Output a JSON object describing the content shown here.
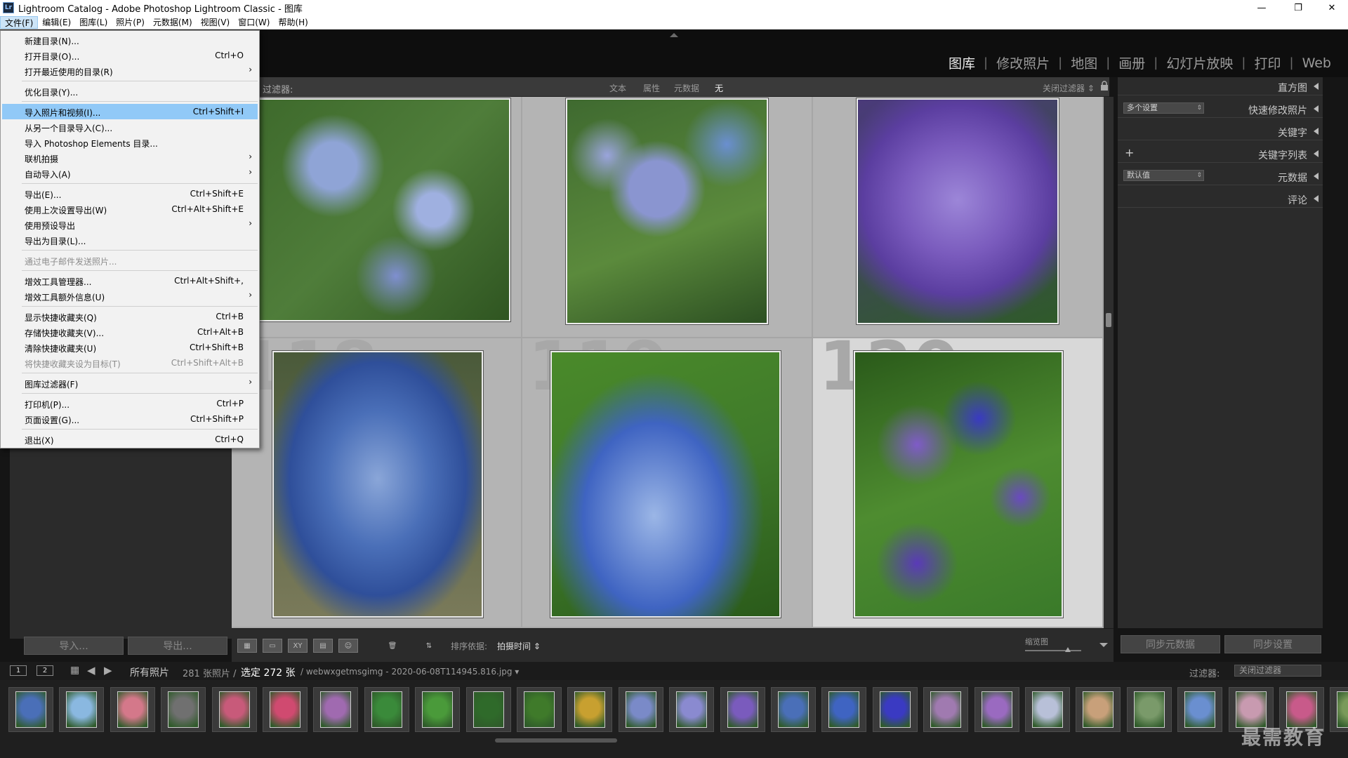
{
  "window": {
    "title": "Lightroom Catalog - Adobe Photoshop Lightroom Classic - 图库",
    "app_icon": "Lr",
    "controls": {
      "minimize": "—",
      "maximize": "❐",
      "close": "✕"
    }
  },
  "menubar": [
    "文件(F)",
    "编辑(E)",
    "图库(L)",
    "照片(P)",
    "元数据(M)",
    "视图(V)",
    "窗口(W)",
    "帮助(H)"
  ],
  "modules": [
    "图库",
    "修改照片",
    "地图",
    "画册",
    "幻灯片放映",
    "打印",
    "Web"
  ],
  "file_menu": {
    "items": [
      {
        "label": "新建目录(N)...",
        "shortcut": ""
      },
      {
        "label": "打开目录(O)...",
        "shortcut": "Ctrl+O"
      },
      {
        "label": "打开最近使用的目录(R)",
        "shortcut": "",
        "submenu": "›"
      },
      {
        "label": "优化目录(Y)...",
        "shortcut": ""
      },
      {
        "label": "导入照片和视频(I)...",
        "shortcut": "Ctrl+Shift+I"
      },
      {
        "label": "从另一个目录导入(C)...",
        "shortcut": ""
      },
      {
        "label": "导入 Photoshop Elements 目录...",
        "shortcut": ""
      },
      {
        "label": "联机拍摄",
        "shortcut": "",
        "submenu": "›"
      },
      {
        "label": "自动导入(A)",
        "shortcut": "",
        "submenu": "›"
      },
      {
        "label": "导出(E)...",
        "shortcut": "Ctrl+Shift+E"
      },
      {
        "label": "使用上次设置导出(W)",
        "shortcut": "Ctrl+Alt+Shift+E"
      },
      {
        "label": "使用预设导出",
        "shortcut": "",
        "submenu": "›"
      },
      {
        "label": "导出为目录(L)...",
        "shortcut": ""
      },
      {
        "label": "通过电子邮件发送照片...",
        "shortcut": ""
      },
      {
        "label": "增效工具管理器...",
        "shortcut": "Ctrl+Alt+Shift+,"
      },
      {
        "label": "增效工具额外信息(U)",
        "shortcut": "",
        "submenu": "›"
      },
      {
        "label": "显示快捷收藏夹(Q)",
        "shortcut": "Ctrl+B"
      },
      {
        "label": "存储快捷收藏夹(V)...",
        "shortcut": "Ctrl+Alt+B"
      },
      {
        "label": "清除快捷收藏夹(U)",
        "shortcut": "Ctrl+Shift+B"
      },
      {
        "label": "将快捷收藏夹设为目标(T)",
        "shortcut": "Ctrl+Shift+Alt+B"
      },
      {
        "label": "图库过滤器(F)",
        "shortcut": "",
        "submenu": "›"
      },
      {
        "label": "打印机(P)...",
        "shortcut": "Ctrl+P"
      },
      {
        "label": "页面设置(G)...",
        "shortcut": "Ctrl+Shift+P"
      },
      {
        "label": "退出(X)",
        "shortcut": "Ctrl+Q"
      }
    ]
  },
  "left_panel": {
    "import_label": "导入...",
    "export_label": "导出..."
  },
  "filter_bar": {
    "label": "过滤器:",
    "tabs": [
      "文本",
      "属性",
      "元数据",
      "无"
    ],
    "preset": "关闭过滤器 ⇕"
  },
  "grid": {
    "cell_numbers": [
      "",
      "",
      "",
      "118",
      "119",
      "120"
    ],
    "photo_colors": [
      [
        "#3e6a2c",
        "#8fa4d6",
        "#4f7d3a"
      ],
      [
        "#3f6a30",
        "#8a95d0",
        "#6a8fd0"
      ],
      [
        "#7a5bbd",
        "#5b3ea0",
        "#9c86d8"
      ],
      [
        "#4a6fb8",
        "#2f4f9a",
        "#8aa6d8"
      ],
      [
        "#3f7a2a",
        "#3f64c2",
        "#9bb6e6"
      ],
      [
        "#4e8c30",
        "#3a3ac2",
        "#7f5bc8"
      ]
    ]
  },
  "right_panel": {
    "histogram": "直方图",
    "quick_develop": "快速修改照片",
    "quick_develop_preset": "多个设置",
    "keywording": "关键字",
    "keyword_list": "关键字列表",
    "keyword_add": "+",
    "metadata": "元数据",
    "metadata_preset": "默认值",
    "comments": "评论",
    "sync_metadata_label": "同步元数据",
    "sync_settings_label": "同步设置"
  },
  "toolbar": {
    "views": [
      "grid-view-icon",
      "loupe-view-icon",
      "compare-view-icon",
      "survey-view-icon",
      "people-view-icon"
    ],
    "compare_text": "XY",
    "sort_label": "排序依据:",
    "sort_value": "拍摄时间 ⇕",
    "thumb_label": "缩览图"
  },
  "filmstrip_header": {
    "monitor1": "1",
    "monitor2": "2",
    "source": "所有照片",
    "count": "281 张照片 /",
    "selected": "选定 272 张",
    "filename": "/ webwxgetmsgimg - 2020-06-08T114945.816.jpg ▾",
    "filter_label": "过滤器:",
    "filter_value": "关闭过滤器"
  },
  "filmstrip": {
    "thumbs": [
      "#4a6fb8",
      "#8ab8e0",
      "#d4788a",
      "#707070",
      "#c85a7a",
      "#d04a70",
      "#a06ab0",
      "#3a8a3a",
      "#4a9a3a",
      "#2f6a2a",
      "#3f7a2a",
      "#c8a030",
      "#7a8ac8",
      "#8a8ad0",
      "#7a5bbd",
      "#4a6fb8",
      "#3f64c2",
      "#3a3ac2",
      "#a07ab0",
      "#9a6ac0",
      "#b8c0d8",
      "#c8a07a",
      "#7a9a6a",
      "#6a8fd0",
      "#c89ab0",
      "#c85a8a",
      "#7a9a5a"
    ],
    "watermark": "最需教育"
  }
}
